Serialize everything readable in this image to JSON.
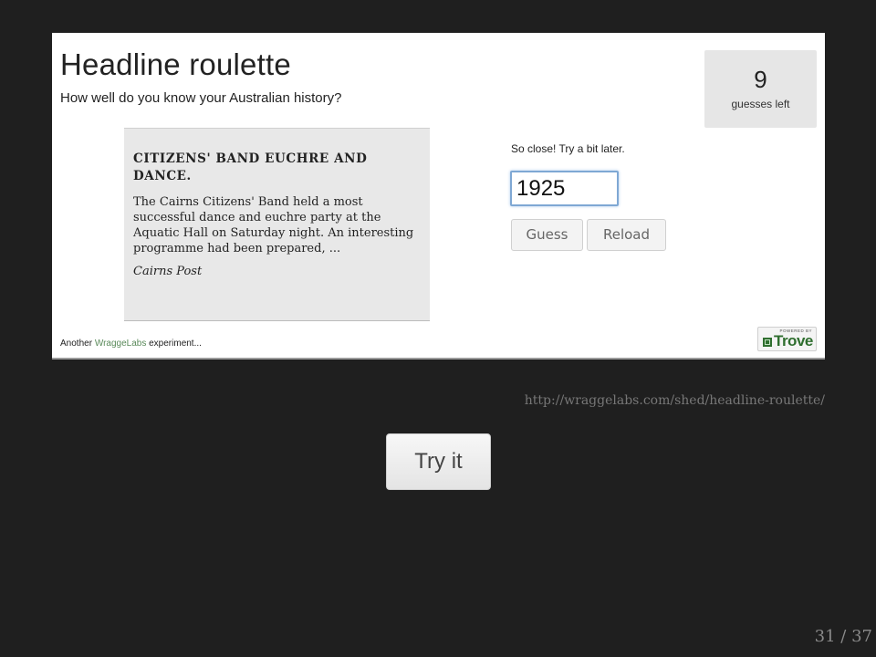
{
  "app": {
    "title": "Headline roulette",
    "subtitle": "How well do you know your Australian history?",
    "guesses": {
      "count": "9",
      "label": "guesses left"
    },
    "article": {
      "headline": "CITIZENS' BAND EUCHRE AND DANCE.",
      "body": "The Cairns Citizens' Band held a most successful dance and euchre party at the Aquatic Hall on Saturday night. An interesting programme had been prepared, ...",
      "source": "Cairns Post"
    },
    "feedback": "So close! Try a bit later.",
    "year_input": {
      "value": "1925"
    },
    "buttons": {
      "guess": "Guess",
      "reload": "Reload"
    },
    "footer": {
      "prefix": "Another ",
      "link": "WraggeLabs",
      "suffix": " experiment..."
    },
    "trove_badge": {
      "powered_by": "POWERED BY",
      "brand": "Trove"
    }
  },
  "slide": {
    "url": "http://wraggelabs.com/shed/headline-roulette/",
    "try_button": "Try it",
    "counter": "31 / 37"
  },
  "colors": {
    "slide_background": "#1f1f1f",
    "panel_background": "#ffffff",
    "article_background": "#e8e8e8",
    "trove_green": "#2f6e2f",
    "input_focus": "#7fa8d4"
  },
  "icons": {
    "trove_logo": "trove-logo-icon"
  }
}
